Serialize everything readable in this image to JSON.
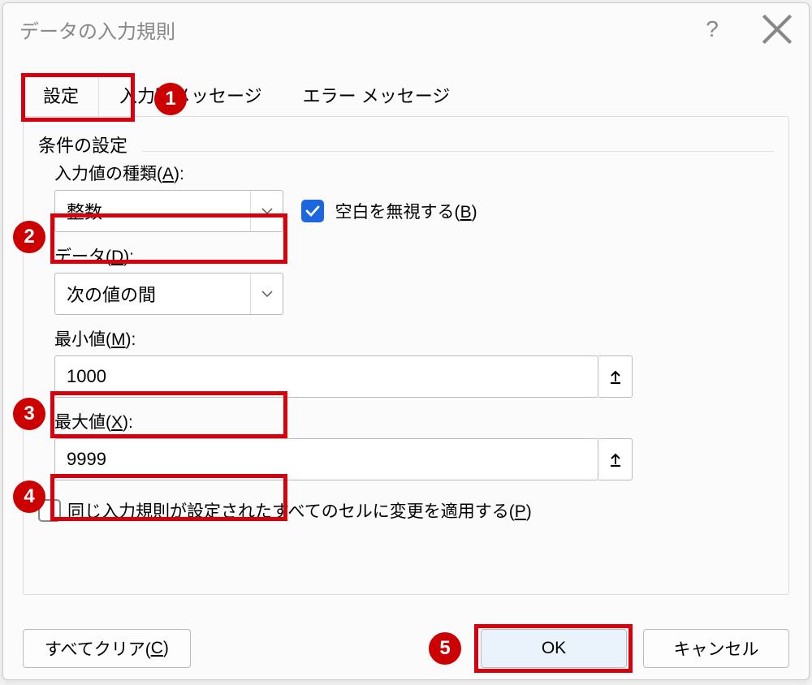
{
  "title": "データの入力規則",
  "tabs": {
    "settings": "設定",
    "inputMessage": "入力時メッセージ",
    "errorMessage": "エラー メッセージ"
  },
  "fieldset": "条件の設定",
  "labels": {
    "allowPre": "入力値の種類(",
    "allowKey": "A",
    "allowPost": "):",
    "ignoreBlankPre": "空白を無視する(",
    "ignoreBlankKey": "B",
    "ignoreBlankPost": ")",
    "dataPre": "データ(",
    "dataKey": "D",
    "dataPost": "):",
    "minPre": "最小値(",
    "minKey": "M",
    "minPost": "):",
    "maxPre": "最大値(",
    "maxKey": "X",
    "maxPost": "):",
    "applyPre": "同じ入力規則が設定されたすべてのセルに変更を適用する(",
    "applyKey": "P",
    "applyPost": ")"
  },
  "values": {
    "allow": "整数",
    "data": "次の値の間",
    "min": "1000",
    "max": "9999"
  },
  "buttons": {
    "clearAllPre": "すべてクリア(",
    "clearAllKey": "C",
    "clearAllPost": ")",
    "ok": "OK",
    "cancel": "キャンセル"
  },
  "badges": {
    "b1": "1",
    "b2": "2",
    "b3": "3",
    "b4": "4",
    "b5": "5"
  }
}
